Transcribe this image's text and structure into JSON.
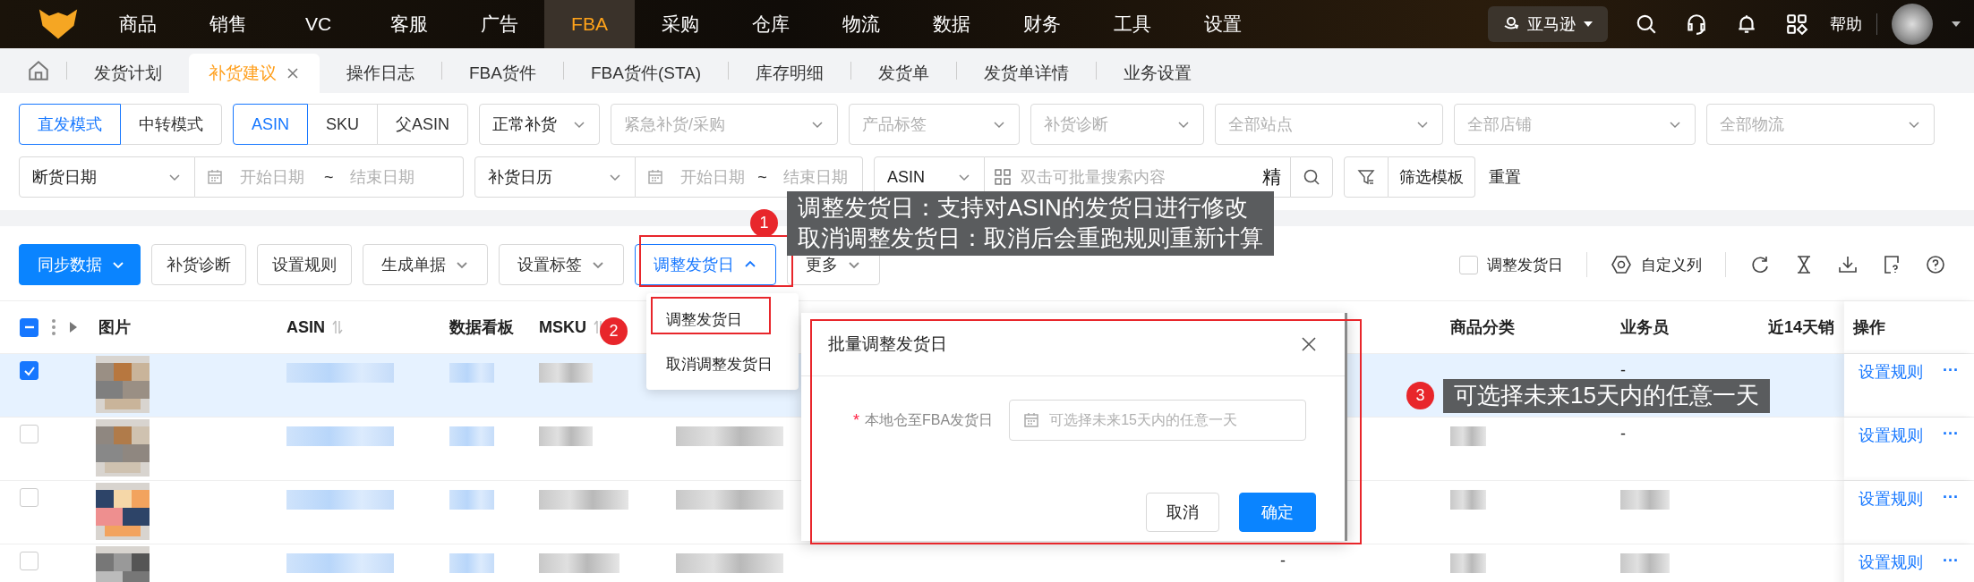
{
  "nav": {
    "items": [
      {
        "label": "商品",
        "selected": false
      },
      {
        "label": "销售",
        "selected": false
      },
      {
        "label": "VC",
        "selected": false
      },
      {
        "label": "客服",
        "selected": false
      },
      {
        "label": "广告",
        "selected": false
      },
      {
        "label": "FBA",
        "selected": true
      },
      {
        "label": "采购",
        "selected": false
      },
      {
        "label": "仓库",
        "selected": false
      },
      {
        "label": "物流",
        "selected": false
      },
      {
        "label": "数据",
        "selected": false
      },
      {
        "label": "财务",
        "selected": false
      },
      {
        "label": "工具",
        "selected": false
      },
      {
        "label": "设置",
        "selected": false
      }
    ],
    "store": "亚马逊",
    "help": "帮助"
  },
  "tabs": [
    {
      "label": "发货计划",
      "selected": false,
      "closable": false
    },
    {
      "label": "补货建议",
      "selected": true,
      "closable": true
    },
    {
      "label": "操作日志",
      "selected": false,
      "closable": false
    },
    {
      "label": "FBA货件",
      "selected": false,
      "closable": false
    },
    {
      "label": "FBA货件(STA)",
      "selected": false,
      "closable": false
    },
    {
      "label": "库存明细",
      "selected": false,
      "closable": false
    },
    {
      "label": "发货单",
      "selected": false,
      "closable": false
    },
    {
      "label": "发货单详情",
      "selected": false,
      "closable": false
    },
    {
      "label": "业务设置",
      "selected": false,
      "closable": false
    }
  ],
  "filters": {
    "modes": [
      {
        "label": "直发模式",
        "selected": true
      },
      {
        "label": "中转模式",
        "selected": false
      }
    ],
    "id_types": [
      {
        "label": "ASIN",
        "selected": true
      },
      {
        "label": "SKU",
        "selected": false
      },
      {
        "label": "父ASIN",
        "selected": false
      }
    ],
    "selects": [
      {
        "value": "正常补货"
      },
      {
        "placeholder": "紧急补货/采购"
      },
      {
        "placeholder": "产品标签"
      },
      {
        "placeholder": "补货诊断"
      },
      {
        "placeholder": "全部站点"
      },
      {
        "placeholder": "全部店铺"
      },
      {
        "placeholder": "全部物流"
      }
    ],
    "date_ranges": [
      {
        "type": "断货日期",
        "start_placeholder": "开始日期",
        "separator": "~",
        "end_placeholder": "结束日期"
      },
      {
        "type": "补货日历",
        "start_placeholder": "开始日期",
        "separator": "~",
        "end_placeholder": "结束日期"
      }
    ],
    "search": {
      "field": "ASIN",
      "placeholder": "双击可批量搜索内容",
      "exact": "精"
    },
    "template_button": "筛选模板",
    "reset": "重置"
  },
  "toolbar": {
    "buttons": [
      {
        "label": "同步数据",
        "kind": "primary",
        "open": false
      },
      {
        "label": "补货诊断",
        "kind": "plain",
        "open": false
      },
      {
        "label": "设置规则",
        "kind": "plain",
        "open": false
      },
      {
        "label": "生成单据",
        "kind": "dropdown",
        "open": false
      },
      {
        "label": "设置标签",
        "kind": "dropdown",
        "open": false
      },
      {
        "label": "调整发货日",
        "kind": "dropdown",
        "open": true
      },
      {
        "label": "更多",
        "kind": "dropdown",
        "open": false
      }
    ],
    "filter_checkbox": {
      "label": "调整发货日",
      "checked": false
    },
    "columns_button": "自定义列"
  },
  "dropdown_menu": {
    "items": [
      "调整发货日",
      "取消调整发货日"
    ]
  },
  "table": {
    "select_all_indeterminate": true,
    "columns": [
      {
        "label": "图片",
        "sortable": false
      },
      {
        "label": "ASIN",
        "sortable": true
      },
      {
        "label": "数据看板",
        "sortable": false
      },
      {
        "label": "MSKU",
        "sortable": true
      },
      {
        "label": "商品分类",
        "sortable": false
      },
      {
        "label": "业务员",
        "sortable": false
      },
      {
        "label": "近14天销",
        "sortable": false
      },
      {
        "label": "操作",
        "sortable": false
      }
    ],
    "rows": [
      {
        "checked": true,
        "selected": true,
        "salesperson": "-",
        "action": "设置规则",
        "more": "···"
      },
      {
        "checked": false,
        "selected": false,
        "salesperson": "-",
        "action": "设置规则",
        "more": "···"
      },
      {
        "checked": false,
        "selected": false,
        "action": "设置规则",
        "more": "···"
      },
      {
        "checked": false,
        "selected": false,
        "column_7": "-",
        "action": "设置规则",
        "more": "···"
      }
    ]
  },
  "modal": {
    "title": "批量调整发货日",
    "required_mark": "*",
    "field_label": "本地仓至FBA发货日",
    "placeholder": "可选择未来15天内的任意一天",
    "cancel": "取消",
    "ok": "确定"
  },
  "callouts": [
    {
      "number": "1",
      "lines": [
        "调整发货日：支持对ASIN的发货日进行修改",
        "取消调整发货日：取消后会重跑规则重新计算"
      ]
    },
    {
      "number": "2"
    },
    {
      "number": "3",
      "lines": [
        "可选择未来15天内的任意一天"
      ]
    }
  ]
}
